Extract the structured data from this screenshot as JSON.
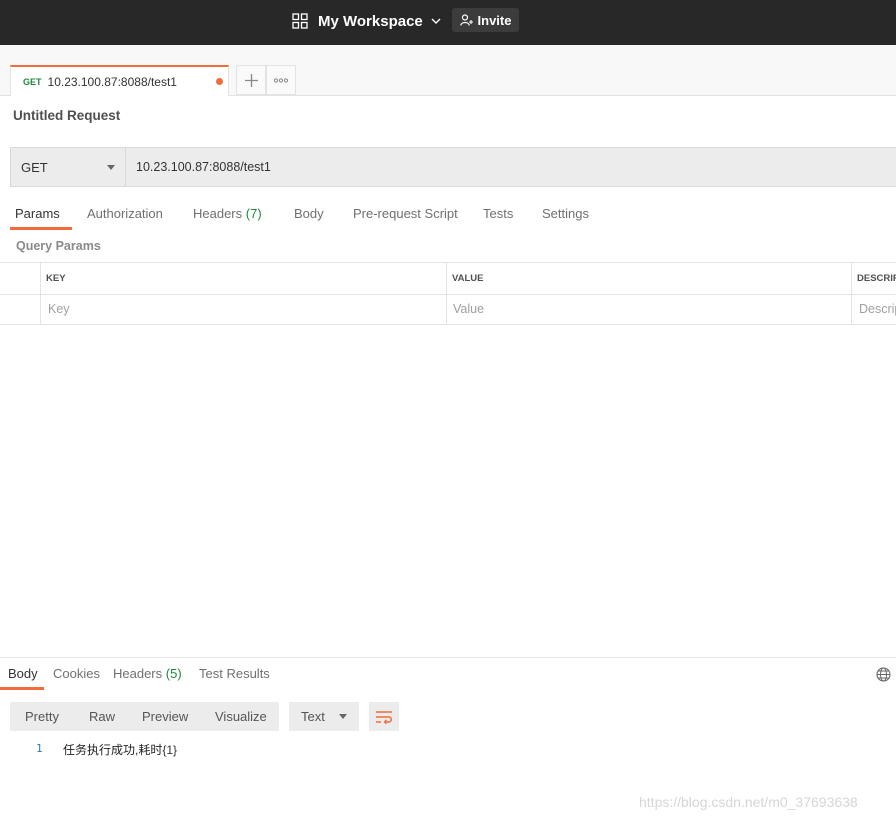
{
  "topbar": {
    "workspace": "My Workspace",
    "invite": "Invite"
  },
  "request_tab": {
    "method": "GET",
    "url": "10.23.100.87:8088/test1"
  },
  "request": {
    "title": "Untitled Request",
    "method": "GET",
    "url": "10.23.100.87:8088/test1",
    "tabs": [
      {
        "label": "Params"
      },
      {
        "label": "Authorization"
      },
      {
        "label": "Headers",
        "count": "(7)"
      },
      {
        "label": "Body"
      },
      {
        "label": "Pre-request Script"
      },
      {
        "label": "Tests"
      },
      {
        "label": "Settings"
      }
    ],
    "active_tab": "Params"
  },
  "params": {
    "heading": "Query Params",
    "columns": [
      "KEY",
      "VALUE",
      "DESCRIPTION"
    ],
    "placeholders": {
      "key": "Key",
      "value": "Value",
      "description": "Description"
    }
  },
  "response": {
    "tabs": [
      {
        "label": "Body"
      },
      {
        "label": "Cookies"
      },
      {
        "label": "Headers",
        "count": "(5)"
      },
      {
        "label": "Test Results"
      }
    ],
    "active_tab": "Body",
    "formats": [
      "Pretty",
      "Raw",
      "Preview",
      "Visualize"
    ],
    "type_select": "Text",
    "lines": [
      {
        "num": "1",
        "text": "任务执行成功,耗时",
        "bracketed": "{1}"
      }
    ]
  },
  "watermark": "https://blog.csdn.net/m0_37693638",
  "colors": {
    "accent": "#f26b3a",
    "get_method": "#1b8a3e",
    "topbar_bg": "#282828"
  }
}
